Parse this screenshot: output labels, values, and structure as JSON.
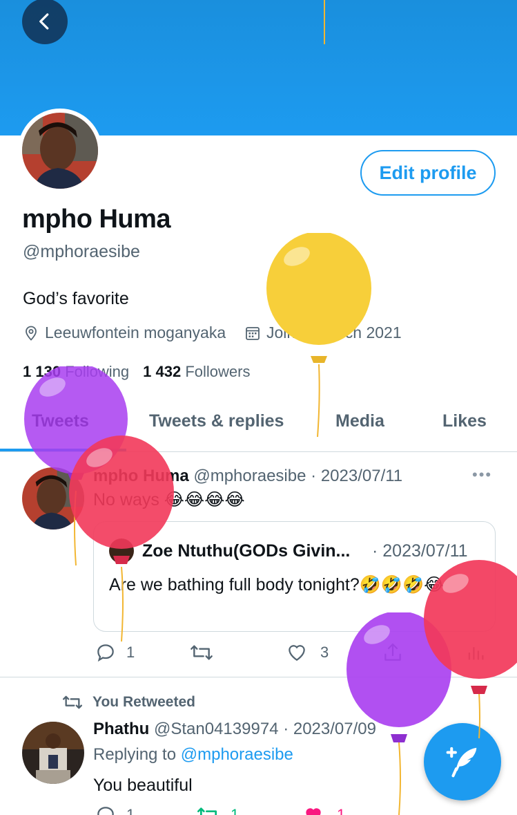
{
  "profile": {
    "name": "mpho Huma",
    "handle": "@mphoraesibe",
    "bio": "God’s favorite",
    "location": "Leeuwfontein moganyaka",
    "joined": "Joined March 2021",
    "following_count": "1 130",
    "following_label": "Following",
    "followers_count": "1 432",
    "followers_label": "Followers",
    "edit_label": "Edit profile"
  },
  "tabs": [
    {
      "label": "Tweets",
      "active": true
    },
    {
      "label": "Tweets & replies",
      "active": false
    },
    {
      "label": "Media",
      "active": false
    },
    {
      "label": "Likes",
      "active": false
    }
  ],
  "tweets": [
    {
      "author": "mpho Huma",
      "handle": "@mphoraesibe",
      "sep": "·",
      "date": "2023/07/11",
      "text": "No ways 😂😂😂😂",
      "quote": {
        "author": "Zoe Ntuthu(GODs Givin...",
        "date": "· 2023/07/11",
        "text": "Are we bathing full body tonight?🤣🤣🤣😂"
      },
      "replies": "1",
      "retweets": "",
      "likes": "3"
    },
    {
      "retweet_label": "You Retweeted",
      "author": "Phathu",
      "handle": "@Stan04139974",
      "sep": "·",
      "date": "2023/07/09",
      "replying_prefix": "Replying to",
      "replying_to": "@mphoraesibe",
      "text": "You beautiful",
      "replies": "1",
      "retweets": "1",
      "likes": "1"
    }
  ],
  "colors": {
    "accent": "#1d9bf0",
    "banner": "#1d9bf0",
    "retweet_green": "#00ba7c",
    "like_red": "#f91880",
    "balloon_yellow": "#f7cf3a",
    "balloon_purple": "#a83df0",
    "balloon_pink": "#f2385a"
  },
  "icons": [
    "back-arrow-icon",
    "location-pin-icon",
    "calendar-icon",
    "more-icon",
    "reply-icon",
    "retweet-icon",
    "like-icon",
    "share-icon",
    "analytics-icon",
    "compose-tweet-icon",
    "balloon-icon"
  ]
}
